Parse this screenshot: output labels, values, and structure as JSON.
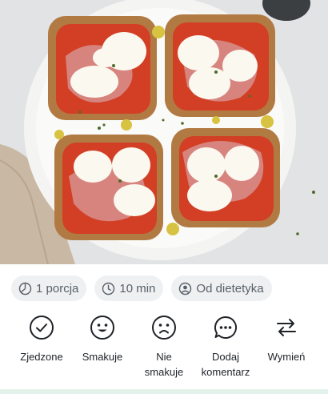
{
  "photo": {
    "alt_name": "bruschetta-photo"
  },
  "chips": [
    {
      "icon": "pie-portion-icon",
      "label": "1 porcja"
    },
    {
      "icon": "clock-icon",
      "label": "10 min"
    },
    {
      "icon": "user-circle-icon",
      "label": "Od dietetyka"
    }
  ],
  "actions": [
    {
      "icon": "check-circle-icon",
      "label": "Zjedzone"
    },
    {
      "icon": "smile-icon",
      "label": "Smakuje"
    },
    {
      "icon": "frown-icon",
      "label": "Nie\nsmakuje"
    },
    {
      "icon": "comment-icon",
      "label": "Dodaj\nkomentarz"
    },
    {
      "icon": "swap-arrows-icon",
      "label": "Wymień"
    }
  ],
  "colors": {
    "chip_bg": "#eef0f2",
    "chip_text": "#59606a",
    "action_text": "#1f2328",
    "bottom_accent": "#e4f2ec"
  }
}
